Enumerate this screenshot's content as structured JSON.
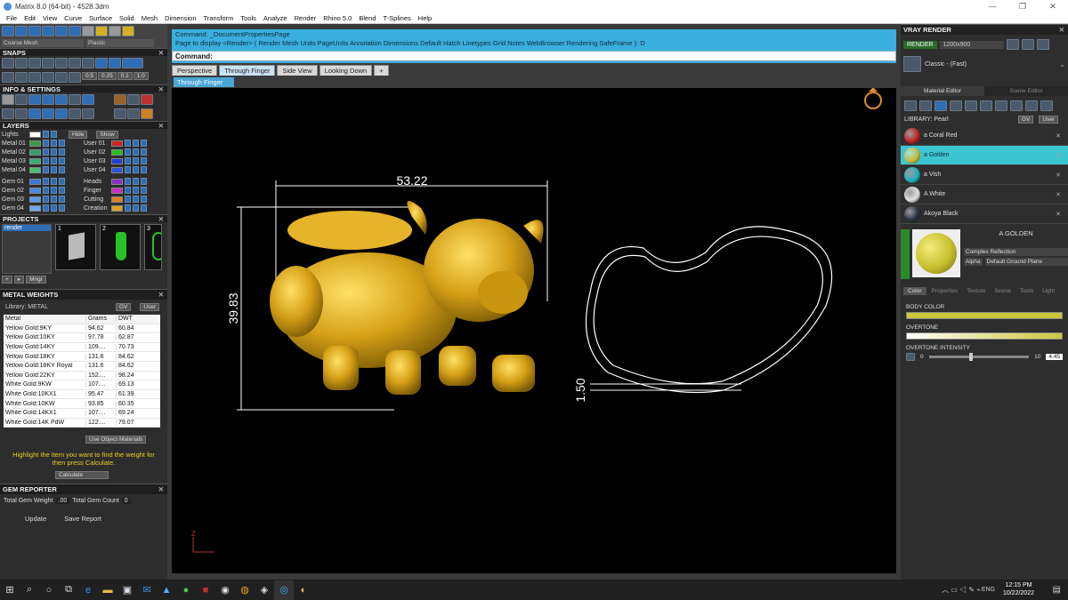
{
  "window": {
    "title": "Matrix 8.0 (64-bit) - 4528.3dm",
    "controls": [
      "—",
      "❐",
      "✕"
    ]
  },
  "menu": [
    "File",
    "Edit",
    "View",
    "Curve",
    "Surface",
    "Solid",
    "Mesh",
    "Dimension",
    "Transform",
    "Tools",
    "Analyze",
    "Render",
    "Rhino 5.0",
    "Blend",
    "T-Splines",
    "Help"
  ],
  "top_left": {
    "mesh_select": "Coarse Mesh",
    "material_select": "Plastic"
  },
  "left": {
    "snaps_title": "SNAPS",
    "snap_values": [
      "0.5",
      "0.25",
      "0.1",
      "1.0"
    ],
    "info_title": "INFO & SETTINGS",
    "layers_title": "LAYERS",
    "layers_top": {
      "label": "Lights",
      "hide": "Hide",
      "show": "Show"
    },
    "layers_left": [
      {
        "name": "Metal 01",
        "color": "#3a9a4a"
      },
      {
        "name": "Metal 02",
        "color": "#2fa06a"
      },
      {
        "name": "Metal 03",
        "color": "#35b070"
      },
      {
        "name": "Metal 04",
        "color": "#4cc070"
      },
      {
        "name": "Gem 01",
        "color": "#3a7ad0"
      },
      {
        "name": "Gem 02",
        "color": "#4a8ae0"
      },
      {
        "name": "Gem 03",
        "color": "#5a9ae8"
      },
      {
        "name": "Gem 04",
        "color": "#6aa8ee"
      }
    ],
    "layers_right": [
      {
        "name": "User 01",
        "color": "#d02020"
      },
      {
        "name": "User 02",
        "color": "#20c020"
      },
      {
        "name": "User 03",
        "color": "#2040d0"
      },
      {
        "name": "User 04",
        "color": "#3050d8"
      },
      {
        "name": "Heads",
        "color": "#8a30c0"
      },
      {
        "name": "Finger",
        "color": "#c030c0"
      },
      {
        "name": "Cutting",
        "color": "#e08020"
      },
      {
        "name": "Creation",
        "color": "#e0a020"
      }
    ],
    "projects_title": "PROJECTS",
    "project_list_item": "render",
    "project_thumbs": [
      "1",
      "2",
      "3"
    ],
    "projects_button": "Mngr",
    "metal_title": "METAL WEIGHTS",
    "metal_library": "Library: METAL",
    "metal_lib_btns": [
      "GV",
      "User"
    ],
    "metal_headers": [
      "Metal",
      "Grams",
      "DWT"
    ],
    "metal_rows": [
      [
        "Yellow Gold:9KY",
        "94.62",
        "60.84"
      ],
      [
        "Yellow Gold:10KY",
        "97.78",
        "62.87"
      ],
      [
        "Yellow Gold:14KY",
        "109....",
        "70.73"
      ],
      [
        "Yellow Gold:18KY",
        "131.6",
        "84.62"
      ],
      [
        "Yellow Gold:18KY Royal",
        "131.6",
        "84.62"
      ],
      [
        "Yellow Gold:22KY",
        "152....",
        "98.24"
      ],
      [
        "White Gold:9KW",
        "107....",
        "69.13"
      ],
      [
        "White Gold:10KX1",
        "95.47",
        "61.39"
      ],
      [
        "White Gold:10KW",
        "93.85",
        "60.35"
      ],
      [
        "White Gold:14KX1",
        "107....",
        "69.24"
      ],
      [
        "White Gold:14K PdW",
        "122....",
        "79.07"
      ]
    ],
    "use_object_materials": "Use Object Materials",
    "hint": "Highlight the item you want to find the weight for then press Calculate.",
    "calculate": "Calculate",
    "gem_title": "GEM REPORTER",
    "gem_weight_label": "Total Gem Weight",
    "gem_weight_value": ".00",
    "gem_count_label": "Total Gem Count",
    "gem_count_value": "0",
    "update": "Update",
    "save_report": "Save Report"
  },
  "command": {
    "line1": "Command: _DocumentPropertiesPage",
    "line2": "Page to display <Render> ( Render  Mesh  Units  PageUnits  Annotation  Dimensions  Default  Hatch  Linetypes  Grid  Notes  WebBrowser  Rendering  SafeFrame ): D",
    "prompt": "Command:"
  },
  "tabs": [
    "Perspective",
    "Through Finger",
    "Side View",
    "Looking Down",
    "+"
  ],
  "subtab": "Through Finger",
  "viewport": {
    "dim_width": "53.22",
    "dim_height": "39.83",
    "dim_thickness": "1.50",
    "model_color": "#d4a017",
    "axis_label": "Z"
  },
  "right": {
    "title": "VRAY RENDER",
    "render_btn": "RENDER",
    "resolution": "1200x900",
    "preset": "Classic - (Fast)",
    "tabs": [
      "Material Editor",
      "Scene Editor"
    ],
    "library": "LIBRARY: Pearl",
    "lib_btns": [
      "GV",
      "User"
    ],
    "materials": [
      {
        "name": "a Coral Red",
        "color": "#c02020",
        "selected": false
      },
      {
        "name": "a Golden",
        "color": "#c8b830",
        "selected": true
      },
      {
        "name": "a Vish",
        "color": "#20b0c0",
        "selected": false
      },
      {
        "name": "A White",
        "color": "#e0e0e0",
        "selected": false
      },
      {
        "name": "Akoya Black",
        "color": "#2a3040",
        "selected": false
      }
    ],
    "preview_name": "A GOLDEN",
    "preview_color": "#c8c030",
    "reflection": "Complex Reflection",
    "alpha_label": "Alpha",
    "ground": "Default Ground Plane",
    "prop_tabs": [
      "Color",
      "Properties",
      "Texture",
      "Scene",
      "Tools",
      "Light"
    ],
    "body_color_label": "BODY COLOR",
    "overtone_label": "OVERTONE",
    "overtone_intensity_label": "OVERTONE INTENSITY",
    "intensity_min": "0",
    "intensity_max": "10",
    "intensity_value": "4.45"
  },
  "taskbar": {
    "time": "12:15 PM",
    "date": "10/22/2022",
    "lang": "ENG"
  }
}
